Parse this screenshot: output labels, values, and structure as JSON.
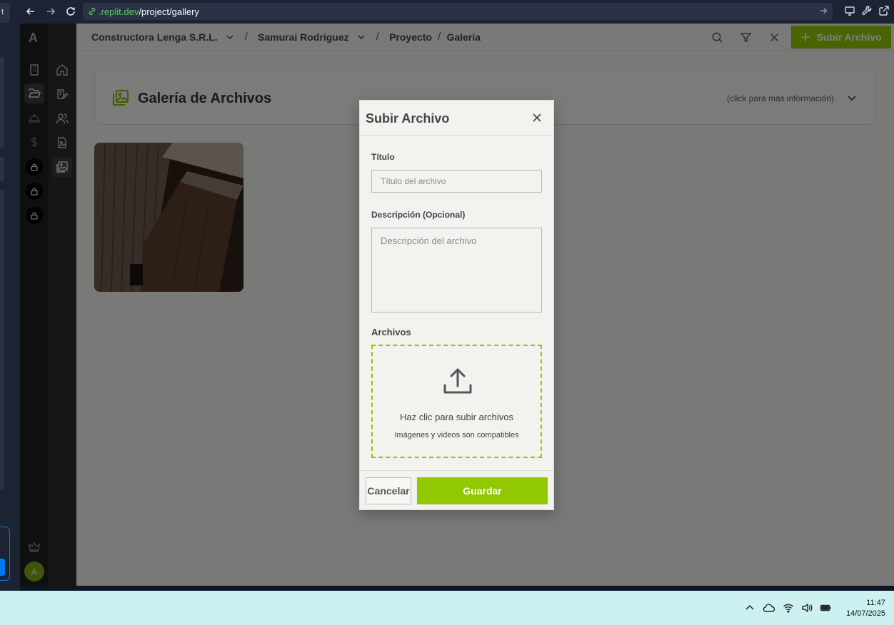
{
  "browser": {
    "url_host": ".replit.dev",
    "url_path": "/project/gallery"
  },
  "replit_strip": {
    "tab_stub": "t"
  },
  "sidebar": {
    "logo": "A",
    "avatar_initial": "A"
  },
  "breadcrumb": {
    "company": "Constructora Lenga S.R.L.",
    "client": "Samurai Rodriguez",
    "project": "Proyecto",
    "page": "Galería",
    "separator": "/"
  },
  "topbar": {
    "upload_button_label": "Subir Archivo"
  },
  "gallery_header": {
    "title": "Galería de Archivos",
    "more_info": "(click para más información)"
  },
  "modal": {
    "title": "Subir Archivo",
    "title_label": "Título",
    "title_placeholder": "Título del archivo",
    "description_label": "Descripción (Opcional)",
    "description_placeholder": "Descripción del archivo",
    "files_label": "Archivos",
    "drop_main": "Haz clic para subir archivos",
    "drop_sub": "Imágenes y videos son compatibles",
    "cancel_label": "Cancelar",
    "save_label": "Guardar"
  },
  "taskbar": {
    "time": "11:47",
    "date": "14/07/2025"
  },
  "colors": {
    "accent": "#92c800",
    "url_host": "#5fc868"
  }
}
